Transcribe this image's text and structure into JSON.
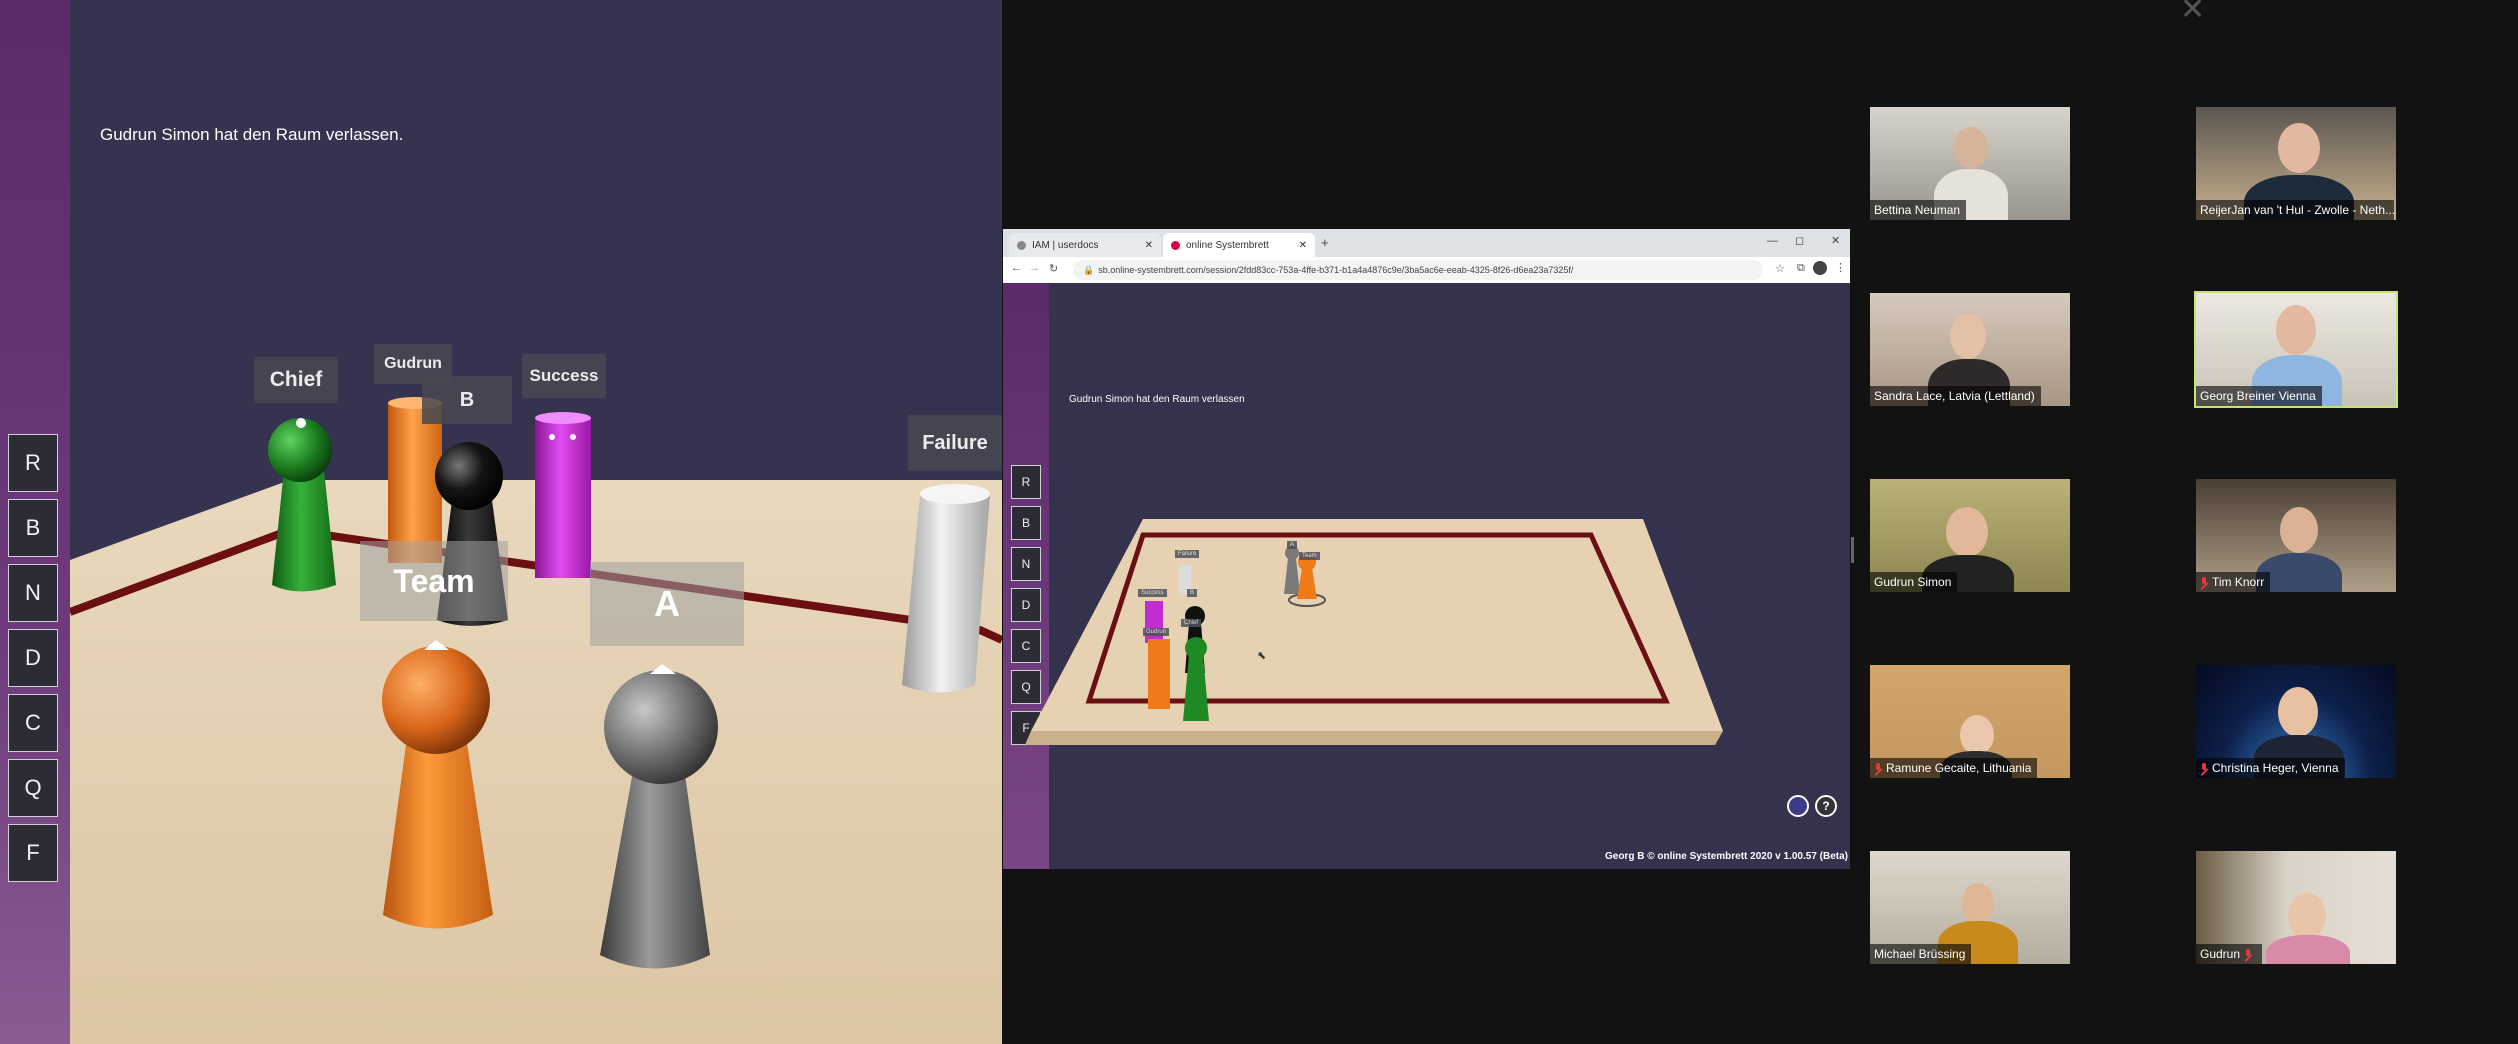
{
  "left_view": {
    "notice": "Gudrun Simon hat den Raum verlassen.",
    "tools": [
      "R",
      "B",
      "N",
      "D",
      "C",
      "Q",
      "F"
    ],
    "labels": {
      "chief": "Chief",
      "gudrun": "Gudrun",
      "b": "B",
      "success": "Success",
      "failure": "Failure",
      "team": "Team",
      "a": "A"
    }
  },
  "browser": {
    "tabs": [
      {
        "label": "IAM | userdocs"
      },
      {
        "label": "online Systembrett"
      }
    ],
    "new_tab": "+",
    "url": "sb.online-systembrett.com/session/2fdd83cc-753a-4ffe-b371-b1a4a4876c9e/3ba5ac6e-eeab-4325-8f26-d6ea23a7325f/",
    "notice": "Gudrun Simon hat den Raum verlassen",
    "tools": [
      "R",
      "B",
      "N",
      "D",
      "C",
      "Q",
      "F"
    ],
    "footer": "Georg B © online Systembrett 2020 v 1.00.57 (Beta)",
    "help": "?"
  },
  "participants": [
    {
      "name": "Bettina Neuman",
      "muted": false
    },
    {
      "name": "ReijerJan van 't Hul - Zwolle - Neth...",
      "muted": false
    },
    {
      "name": "Sandra Lace, Latvia (Lettland)",
      "muted": false
    },
    {
      "name": "Georg Breiner Vienna",
      "muted": false
    },
    {
      "name": "Gudrun Simon",
      "muted": false
    },
    {
      "name": "Tim Knorr",
      "muted": true
    },
    {
      "name": "Ramune Gecaite, Lithuania",
      "muted": true
    },
    {
      "name": "Christina Heger, Vienna",
      "muted": true
    },
    {
      "name": "Michael Brüssing",
      "muted": false
    },
    {
      "name": "Gudrun",
      "muted": true
    }
  ],
  "colors": {
    "scene_bg": "#35334f",
    "sidebar": "#6e3a7c",
    "board": "#e6d2b2",
    "board_line": "#6b0f12",
    "piece_green": "#1f8a24",
    "piece_orange": "#ee7a18",
    "piece_black": "#111111",
    "piece_magenta": "#c02ed0",
    "piece_grey": "#8a8a8a",
    "piece_white": "#d8d8d8",
    "speaking_outline": "#c6e36e"
  }
}
